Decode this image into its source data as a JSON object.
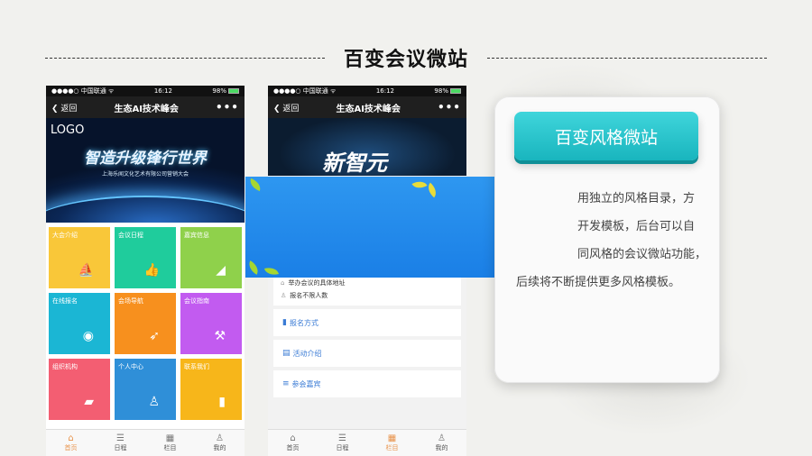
{
  "title": "百变会议微站",
  "phone1": {
    "status_left": "●●●●○ 中国联通 ᯤ",
    "status_time": "16:12",
    "status_battery": "98%",
    "back_label": "返回",
    "nav_title": "生态AI技术峰会",
    "more_label": "•••",
    "banner_logo": "LOGO",
    "banner_slogan": "智造升级锋行世界",
    "banner_sub": "上海乐闻文化艺术有限公司营销大会",
    "tiles": [
      {
        "label": "大会介绍",
        "color": "#f9c739",
        "icon": "sailboat-icon"
      },
      {
        "label": "会议日程",
        "color": "#1fcc9c",
        "icon": "thumbs-up-icon"
      },
      {
        "label": "嘉宾信息",
        "color": "#8fd14b",
        "icon": "speaker-icon"
      },
      {
        "label": "在线报名",
        "color": "#1bb6d4",
        "icon": "globe-icon"
      },
      {
        "label": "会场导航",
        "color": "#f7901e",
        "icon": "runner-icon"
      },
      {
        "label": "会议指南",
        "color": "#c25bf0",
        "icon": "gavel-icon"
      },
      {
        "label": "组织机构",
        "color": "#f35e72",
        "icon": "chat-icon"
      },
      {
        "label": "个人中心",
        "color": "#2f8fd8",
        "icon": "user-icon"
      },
      {
        "label": "联系我们",
        "color": "#f7b61a",
        "icon": "bar-chart-icon"
      }
    ],
    "tabs": [
      {
        "label": "首页",
        "icon": "home-icon",
        "active": true
      },
      {
        "label": "日程",
        "icon": "list-icon",
        "active": false
      },
      {
        "label": "栏目",
        "icon": "grid-icon",
        "active": false
      },
      {
        "label": "我的",
        "icon": "person-icon",
        "active": false
      }
    ]
  },
  "phone2": {
    "status_left": "●●●●○ 中国联通 ᯤ",
    "status_time": "16:12",
    "status_battery": "98%",
    "back_label": "返回",
    "nav_title": "生态AI技术峰会",
    "more_label": "•••",
    "banner_text": "新智元",
    "info_lines": [
      "举办会议的具体地址",
      "报名不限人数"
    ],
    "menu": [
      {
        "label": "报名方式",
        "icon": "bookmark-icon"
      },
      {
        "label": "活动介绍",
        "icon": "document-icon"
      },
      {
        "label": "参会嘉宾",
        "icon": "menu-icon"
      }
    ],
    "tabs": [
      {
        "label": "首页",
        "icon": "home-icon",
        "active": false
      },
      {
        "label": "日程",
        "icon": "list-icon",
        "active": false
      },
      {
        "label": "栏目",
        "icon": "grid-icon",
        "active": true
      },
      {
        "label": "我的",
        "icon": "person-icon",
        "active": false
      }
    ]
  },
  "card": {
    "button_label": "百变风格微站",
    "description_lines": [
      "用独立的风格目录，方",
      "开发模板，后台可以自",
      "同风格的会议微站功能，",
      "后续将不断提供更多风格模板。"
    ]
  },
  "colors": {
    "accent": "#1fbcc4",
    "active_tab": "#e8934c",
    "overlay_blue": "#2a8ff0"
  }
}
